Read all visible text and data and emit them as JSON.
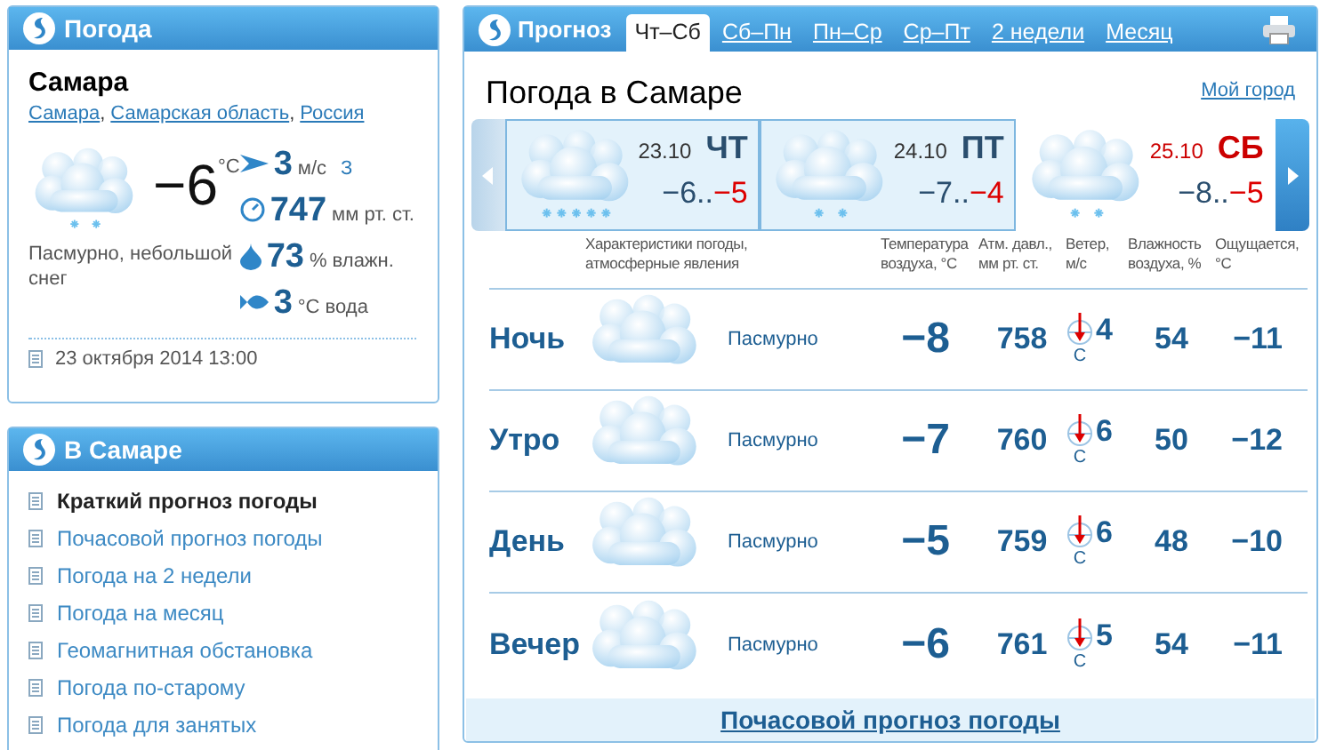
{
  "current": {
    "header": "Погода",
    "city": "Самара",
    "location": [
      {
        "text": "Самара",
        "sep": ","
      },
      {
        "text": "Самарская область",
        "sep": ","
      },
      {
        "text": "Россия"
      }
    ],
    "kind": "light-snow",
    "temp": "−6",
    "unit": "°C",
    "condition": "Пасмурно, небольшой снег",
    "stats": [
      {
        "kind": "wind",
        "value": "3",
        "unit": "м/с",
        "extra": "З"
      },
      {
        "kind": "pressure",
        "value": "747",
        "unit": "мм рт. ст."
      },
      {
        "kind": "humidity",
        "value": "73",
        "unit": "% влажн."
      },
      {
        "kind": "water",
        "value": "3",
        "unit": "°C вода"
      }
    ],
    "updated": "23 октября 2014 13:00"
  },
  "city_menu": {
    "header": "В Самаре",
    "items": [
      {
        "label": "Краткий прогноз погоды",
        "selected": true
      },
      {
        "label": "Почасовой прогноз погоды",
        "selected": false
      },
      {
        "label": "Погода на 2 недели",
        "selected": false
      },
      {
        "label": "Погода на месяц",
        "selected": false
      },
      {
        "label": "Геомагнитная обстановка",
        "selected": false
      },
      {
        "label": "Погода по-старому",
        "selected": false
      },
      {
        "label": "Погода для занятых",
        "selected": false
      }
    ]
  },
  "forecast": {
    "header": "Прогноз",
    "tabs": [
      {
        "label": "Чт–Сб",
        "selected": true
      },
      {
        "label": "Сб–Пн",
        "selected": false
      },
      {
        "label": "Пн–Ср",
        "selected": false
      },
      {
        "label": "Ср–Пт",
        "selected": false
      },
      {
        "label": "2 недели",
        "selected": false
      },
      {
        "label": "Месяц",
        "selected": false
      }
    ],
    "title": "Погода в Самаре",
    "my_city": "Мой город",
    "days": [
      {
        "date": "23.10",
        "weekday": "ЧТ",
        "min": "−6..",
        "max": "−5",
        "weekend": false,
        "selected": true,
        "kind": "snow"
      },
      {
        "date": "24.10",
        "weekday": "ПТ",
        "min": "−7..",
        "max": "−4",
        "weekend": false,
        "selected": true,
        "kind": "light-snow"
      },
      {
        "date": "25.10",
        "weekday": "СБ",
        "min": "−8..",
        "max": "−5",
        "weekend": true,
        "selected": false,
        "kind": "light-snow"
      }
    ],
    "columns": [
      "Характеристики погоды,\nатмосферные явления",
      "Температура\nвоздуха, °C",
      "Атм. давл.,\nмм рт. ст.",
      "Ветер,\nм/с",
      "Влажность\nвоздуха, %",
      "Ощущается,\n°C"
    ],
    "rows": [
      {
        "period": "Ночь",
        "kind": "cloudy",
        "condition": "Пасмурно",
        "temp": "−8",
        "pressure": "758",
        "wind": "4",
        "wind_dir": "С",
        "humidity": "54",
        "feels": "−11"
      },
      {
        "period": "Утро",
        "kind": "cloudy",
        "condition": "Пасмурно",
        "temp": "−7",
        "pressure": "760",
        "wind": "6",
        "wind_dir": "С",
        "humidity": "50",
        "feels": "−12"
      },
      {
        "period": "День",
        "kind": "cloudy",
        "condition": "Пасмурно",
        "temp": "−5",
        "pressure": "759",
        "wind": "6",
        "wind_dir": "С",
        "humidity": "48",
        "feels": "−10"
      },
      {
        "period": "Вечер",
        "kind": "cloudy",
        "condition": "Пасмурно",
        "temp": "−6",
        "pressure": "761",
        "wind": "5",
        "wind_dir": "С",
        "humidity": "54",
        "feels": "−11"
      }
    ],
    "hourly_link": "Почасовой прогноз погоды"
  }
}
